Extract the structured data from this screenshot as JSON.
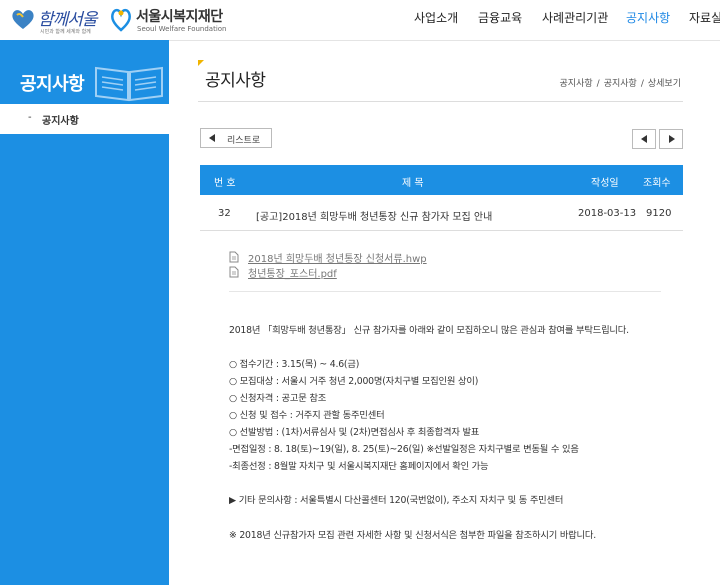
{
  "logos": {
    "together_seoul": {
      "title": "함께서울",
      "subtitle": "시민과 함께 세계와 함께"
    },
    "foundation": {
      "title": "서울시복지재단",
      "subtitle": "Seoul Welfare Foundation"
    }
  },
  "nav": {
    "items": [
      "사업소개",
      "금융교육",
      "사례관리기관",
      "공지사항",
      "자료실"
    ],
    "active_index": 3
  },
  "sidebar": {
    "title": "공지사항",
    "menu": [
      {
        "dash": "-",
        "label": "공지사항"
      }
    ]
  },
  "page": {
    "title": "공지사항",
    "breadcrumb": [
      "공지사항",
      "공지사항",
      "상세보기"
    ],
    "separator": "/"
  },
  "toolbar": {
    "list_label": "리스트로"
  },
  "table": {
    "headers": [
      "번 호",
      "제 목",
      "작성일",
      "조회수"
    ],
    "row": {
      "number": "32",
      "title": "[공고]2018년 희망두배 청년통장 신규 참가자 모집 안내",
      "date": "2018-03-13",
      "views": "9120"
    }
  },
  "attachments": [
    "2018년 희망두배 청년통장 신청서류.hwp",
    "청년통장_포스터.pdf"
  ],
  "body": {
    "lines": [
      "2018년 「희망두배 청년통장」 신규 참가자를 아래와 같이 모집하오니 많은 관심과 참여를 부탁드립니다.",
      "○ 접수기간 : 3.15(목) ~ 4.6(금)",
      "○ 모집대상 : 서울시 거주 청년 2,000명(자치구별 모집인원 상이)",
      "○ 신청자격 : 공고문 참조",
      "○ 신청 및 접수 : 거주지 관할 동주민센터",
      "○ 선발방법 : (1차)서류심사 및 (2차)면접심사 후 최종합격자 발표",
      "-면접일정 : 8. 18(토)~19(일), 8. 25(토)~26(일) ※선발일정은 자치구별로 변동될 수 있음",
      "-최종선정 : 8월말 자치구 및 서울시복지재단 홈페이지에서 확인 가능",
      "▶ 기타 문의사항 : 서울특별시 다산콜센터 120(국번없이), 주소지 자치구 및 동 주민센터",
      "※ 2018년 신규참가자 모집 관련 자세한 사항 및 신청서식은 첨부한 파일을 참조하시기 바랍니다."
    ]
  },
  "colors": {
    "primary": "#1c8fe3",
    "accent_corner": "#f0b400",
    "nav_active": "#1e88e5"
  },
  "icons": [
    "heart-logo-icon",
    "foundation-logo-icon",
    "book-icon",
    "file-icon",
    "arrow-left-icon",
    "arrow-right-icon"
  ]
}
